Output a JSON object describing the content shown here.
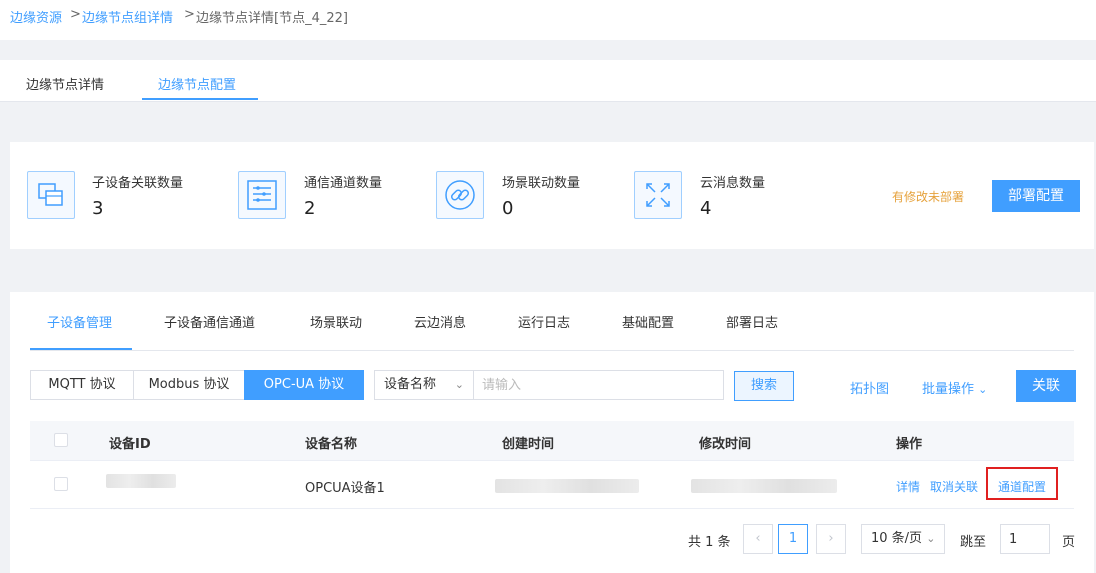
{
  "breadcrumb": {
    "crumb1": "边缘资源",
    "sep1": ">",
    "crumb2": "边缘节点组详情",
    "sep2": ">",
    "current": "边缘节点详情[节点_4_22]"
  },
  "top_tabs": [
    "边缘节点详情",
    "边缘节点配置"
  ],
  "stats": [
    {
      "label": "子设备关联数量",
      "value": "3",
      "icon": "device-stack-icon"
    },
    {
      "label": "通信通道数量",
      "value": "2",
      "icon": "channel-list-icon"
    },
    {
      "label": "场景联动数量",
      "value": "0",
      "icon": "link-chain-icon"
    },
    {
      "label": "云消息数量",
      "value": "4",
      "icon": "arrows-expand-icon"
    }
  ],
  "unsaved_notice": "有修改未部署",
  "deploy_button": "部署配置",
  "main_tabs": [
    "子设备管理",
    "子设备通信通道",
    "场景联动",
    "云边消息",
    "运行日志",
    "基础配置",
    "部署日志"
  ],
  "protocols": [
    "MQTT 协议",
    "Modbus 协议",
    "OPC-UA 协议"
  ],
  "filter": {
    "field": "设备名称",
    "placeholder": "请输入",
    "search": "搜索"
  },
  "actions": {
    "topology": "拓扑图",
    "batch": "批量操作",
    "associate": "关联"
  },
  "table": {
    "columns": [
      "设备ID",
      "设备名称",
      "创建时间",
      "修改时间",
      "操作"
    ],
    "rows": [
      {
        "name": "OPCUA设备1",
        "ops": [
          "详情",
          "取消关联",
          "通道配置"
        ]
      }
    ]
  },
  "pagination": {
    "total": "共 1 条",
    "current": "1",
    "prev": "‹",
    "next": "›",
    "size": "10 条/页",
    "jump_label": "跳至",
    "jump_value": "1",
    "page_unit": "页"
  },
  "colors": {
    "accent": "#409eff",
    "warning": "#e6a23c",
    "highlight": "#e02020"
  }
}
